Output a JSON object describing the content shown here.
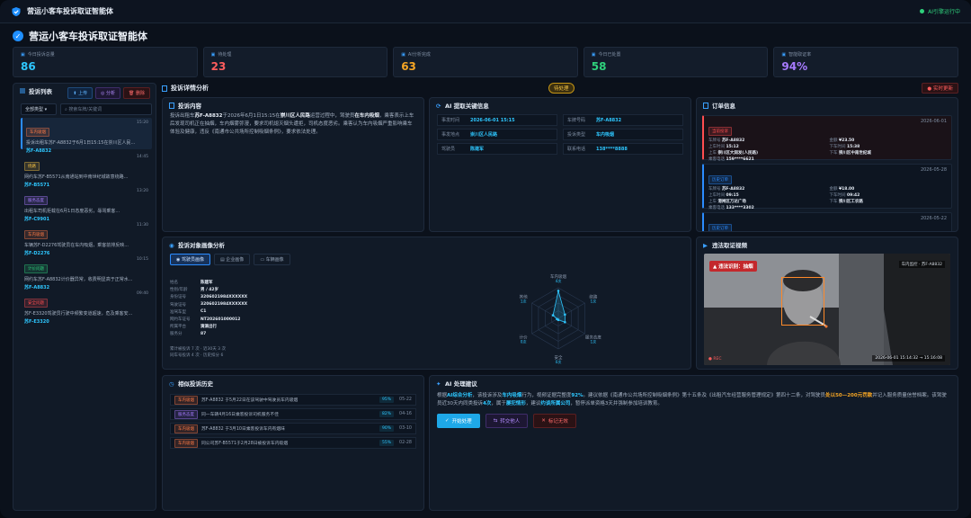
{
  "topbar": {
    "title": "营运小客车投诉取证智能体",
    "status": "AI引擎运行中"
  },
  "page": {
    "title": "营运小客车投诉取证智能体"
  },
  "stats": [
    {
      "label": "今日投诉总量",
      "value": "86",
      "color": "#2ec7ff",
      "icon": "chat-icon"
    },
    {
      "label": "待处理",
      "value": "23",
      "color": "#ff5d5d",
      "icon": "clock-icon"
    },
    {
      "label": "AI分析完成",
      "value": "63",
      "color": "#f5a524",
      "icon": "ai-icon"
    },
    {
      "label": "今日已处置",
      "value": "58",
      "color": "#2fd17c",
      "icon": "check-icon"
    },
    {
      "label": "智能取证率",
      "value": "94%",
      "color": "#a77bff",
      "icon": "shield-icon"
    }
  ],
  "list": {
    "title": "投诉列表",
    "buttons": {
      "upload": "上传",
      "analyze": "分析",
      "delete": "删除"
    },
    "filter": "全部类型",
    "search_placeholder": "搜索车牌/关键词",
    "items": [
      {
        "tag": "车内吸烟",
        "tag_color": "#ff7a45",
        "time": "15:20",
        "text": "投诉出租车苏F-A8832于6月1日15:15在崇川区人民...",
        "plate": "苏F-A8832"
      },
      {
        "tag": "绕路",
        "tag_color": "#f5c244",
        "time": "14:45",
        "text": "网约车苏F-B5571从南通站到中南世纪城故意绕路...",
        "plate": "苏F-B5571"
      },
      {
        "tag": "服务态度",
        "tag_color": "#a77bff",
        "time": "13:20",
        "text": "出租车司机拒载在6月1日态度恶劣，辱骂乘客...",
        "plate": "苏F-C9901"
      },
      {
        "tag": "车内吸烟",
        "tag_color": "#ff7a45",
        "time": "11:30",
        "text": "车辆苏F-D2276驾驶员在车内吸烟，乘客前排反映...",
        "plate": "苏F-D2276"
      },
      {
        "tag": "计价问题",
        "tag_color": "#2fd17c",
        "time": "10:15",
        "text": "网约车苏F-A8832计价器异常，收费明显高于正常水...",
        "plate": "苏F-A8832"
      },
      {
        "tag": "安全问题",
        "tag_color": "#ff4d4f",
        "time": "09:40",
        "text": "苏F-E3320驾驶员行驶中频繁变道超速，危及乘客安...",
        "plate": "苏F-E3320"
      }
    ]
  },
  "detail": {
    "title": "投诉详情分析",
    "status": "待处理",
    "live": "实时更新",
    "content": {
      "title": "投诉内容",
      "p1": "投诉出租车",
      "plate": "苏F-A8832",
      "p2": "于2026年6月1日15:15在",
      "place": "崇川区人民路",
      "p3": "运营过程中，驾驶员",
      "behavior": "在车内吸烟",
      "p4": "，乘客表示上车后发现司机正在抽烟，车内烟雾弥漫，要求司机熄灭烟头遭拒，司机态度恶劣。乘客认为车内吸烟严重影响乘车体验及健康，违反《南通市公共场所控制吸烟条例》，要求依法处理。"
    },
    "ai_info": {
      "title": "AI 提取关键信息",
      "fields": [
        {
          "k": "事发时间",
          "v": "2026-06-01 15:15"
        },
        {
          "k": "车牌号码",
          "v": "苏F-A8832"
        },
        {
          "k": "事发地点",
          "v": "崇川区人民路"
        },
        {
          "k": "投诉类型",
          "v": "车内吸烟"
        },
        {
          "k": "驾驶员",
          "v": "陈建军"
        },
        {
          "k": "联系电话",
          "v": "138****8888"
        }
      ]
    },
    "orders": {
      "title": "订单信息",
      "items": [
        {
          "tag": "当前投诉",
          "tag_color": "#ff4d4f",
          "date": "2026-06-01",
          "plate": "苏F-A8832",
          "amount": "¥23.50",
          "board": "15:12",
          "alight": "15:38",
          "from": "崇川区大润发(人民路)",
          "to": "崇川区中南世纪城",
          "phone": "159****6621",
          "red": true
        },
        {
          "tag": "历史订单",
          "tag_color": "#2b8cff",
          "date": "2026-05-28",
          "plate": "苏F-A8832",
          "amount": "¥18.00",
          "board": "09:15",
          "alight": "09:42",
          "from": "港闸区万达广场",
          "to": "崇川区工农路",
          "phone": "133****3302",
          "red": false
        },
        {
          "tag": "历史订单",
          "tag_color": "#2b8cff",
          "date": "2026-05-22",
          "plate": "苏F-A8832",
          "amount": "¥31.20",
          "board": "",
          "alight": "",
          "from": "",
          "to": "",
          "phone": "",
          "red": false
        }
      ],
      "labels": {
        "plate": "车牌号",
        "amount": "金额",
        "board": "上车时间",
        "alight": "下车时间",
        "from": "上车",
        "to": "下车",
        "phone": "乘客电话"
      }
    },
    "portrait": {
      "title": "投诉对象画像分析",
      "tabs": [
        "驾驶员画像",
        "企业画像",
        "车辆画像"
      ],
      "rows": [
        {
          "k": "姓名",
          "v": "陈建军"
        },
        {
          "k": "性别/年龄",
          "v": "男 / 42岁"
        },
        {
          "k": "身份证号",
          "v": "3206021984XXXXXX"
        },
        {
          "k": "驾驶证号",
          "v": "3206021984XXXXXX"
        },
        {
          "k": "准驾车型",
          "v": "C1"
        },
        {
          "k": "网约车证号",
          "v": "NT202601000012"
        },
        {
          "k": "所属平台",
          "v": "滴滴出行"
        },
        {
          "k": "服务分",
          "v": "87"
        }
      ],
      "note1": "累计被投诉 7 次 · 近30天 3 次",
      "note2": "同车号投诉 4 次 · 历史扣分 6",
      "radar": {
        "labels": [
          "车内吸烟",
          "绕路",
          "服务态度",
          "安全",
          "计价",
          "其他"
        ],
        "subs": [
          "4次",
          "1次",
          "1次",
          "0次",
          "0次",
          "1次"
        ],
        "values": [
          0.9,
          0.25,
          0.25,
          0.05,
          0.05,
          0.2
        ]
      }
    },
    "video": {
      "title": "违法取证视频",
      "badge": "违法识别：抽烟",
      "cam": "车内监控 · 苏F-A8832",
      "stamp": "2026-06-01 15:14:32 → 15:16:08",
      "rec": "REC"
    },
    "similar": {
      "title": "相似投诉历史",
      "items": [
        {
          "tag": "车内吸烟",
          "tag_color": "#ff7a45",
          "text": "苏F-A8832 于5月22日在该驾驶中驾驶员车内吸烟",
          "pct": "95%",
          "date": "05-22"
        },
        {
          "tag": "服务态度",
          "tag_color": "#a77bff",
          "text": "同一车辆4月16日乘客投诉司机服务不佳",
          "pct": "82%",
          "date": "04-16"
        },
        {
          "tag": "车内吸烟",
          "tag_color": "#ff7a45",
          "text": "苏F-A8832 于3月10日乘客投诉车内有烟味",
          "pct": "90%",
          "date": "03-10"
        },
        {
          "tag": "车内吸烟",
          "tag_color": "#ff7a45",
          "text": "同公司苏F-B5571于2月28日被投诉车内吸烟",
          "pct": "55%",
          "date": "02-28"
        }
      ]
    },
    "suggest": {
      "title": "AI 处理建议",
      "text1": "根据",
      "h1": "AI综合分析",
      "text2": "，该投诉涉及",
      "h2": "车内吸烟",
      "text3": "行为，视频证据完整度",
      "h3": "92%",
      "text4": "。建议依据《南通市公共场所控制吸烟条例》第十五条及《出租汽车经营服务管理规定》第四十二条，对驾驶员",
      "h4": "处以50—200元罚款",
      "text5": "并记入服务质量信誉档案。该驾驶员近30天内同类投诉",
      "h5": "4次",
      "text6": "，属于",
      "h6": "屡犯情形",
      "text7": "，建议",
      "h7": "约谈所属公司",
      "text8": "，暂停派单资格3天并强制参加培训教育。",
      "buttons": {
        "process": "开始处理",
        "transfer": "转交他人",
        "invalid": "标记无效"
      }
    }
  }
}
